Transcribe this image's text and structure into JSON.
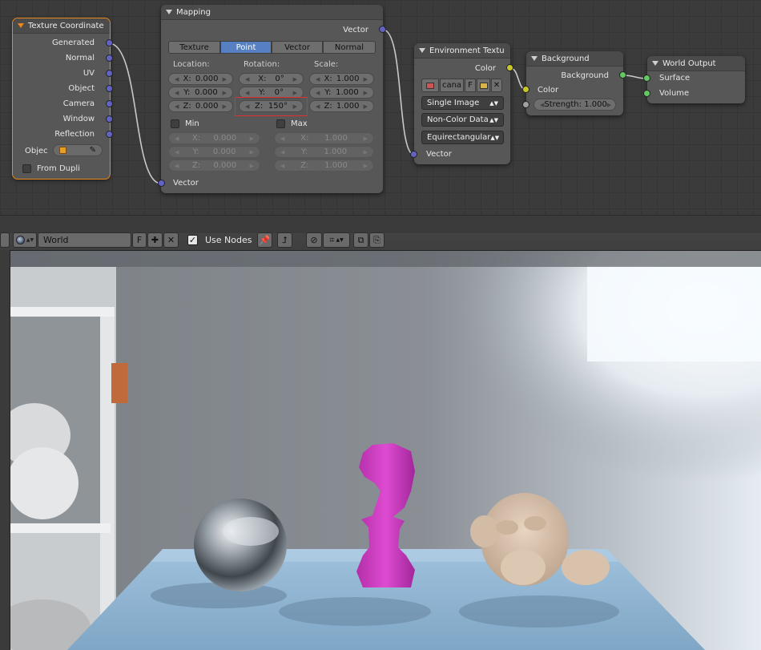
{
  "nodes": {
    "texture_coordinate": {
      "title": "Texture Coordinate",
      "outputs": [
        "Generated",
        "Normal",
        "UV",
        "Object",
        "Camera",
        "Window",
        "Reflection"
      ],
      "object_label": "Objec",
      "from_dupli_label": "From Dupli"
    },
    "mapping": {
      "title": "Mapping",
      "output_label": "Vector",
      "input_label": "Vector",
      "tabs": [
        "Texture",
        "Point",
        "Vector",
        "Normal"
      ],
      "active_tab": "Point",
      "headers": {
        "location": "Location:",
        "rotation": "Rotation:",
        "scale": "Scale:"
      },
      "location": [
        {
          "axis": "X:",
          "value": "0.000"
        },
        {
          "axis": "Y:",
          "value": "0.000"
        },
        {
          "axis": "Z:",
          "value": "0.000"
        }
      ],
      "rotation": [
        {
          "axis": "X:",
          "value": "0°"
        },
        {
          "axis": "Y:",
          "value": "0°"
        },
        {
          "axis": "Z:",
          "value": "150°"
        }
      ],
      "scale": [
        {
          "axis": "X:",
          "value": "1.000"
        },
        {
          "axis": "Y:",
          "value": "1.000"
        },
        {
          "axis": "Z:",
          "value": "1.000"
        }
      ],
      "min_label": "Min",
      "max_label": "Max",
      "min": [
        {
          "axis": "X:",
          "value": "0.000"
        },
        {
          "axis": "Y:",
          "value": "0.000"
        },
        {
          "axis": "Z:",
          "value": "0.000"
        }
      ],
      "max": [
        {
          "axis": "X:",
          "value": "1.000"
        },
        {
          "axis": "Y:",
          "value": "1.000"
        },
        {
          "axis": "Z:",
          "value": "1.000"
        }
      ]
    },
    "environment_texture": {
      "title": "Environment Textu",
      "output_label": "Color",
      "image_name": "cana",
      "fake_user": "F",
      "projection_source": "Single Image",
      "color_space": "Non-Color Data",
      "projection": "Equirectangular",
      "input_label": "Vector"
    },
    "background": {
      "title": "Background",
      "output_label": "Background",
      "color_label": "Color",
      "strength_label": "Strength:",
      "strength_value": "1.000"
    },
    "world_output": {
      "title": "World Output",
      "surface_label": "Surface",
      "volume_label": "Volume"
    }
  },
  "header": {
    "world_name": "World",
    "fake_user": "F",
    "use_nodes_label": "Use Nodes"
  },
  "colors": {
    "accent_active_node": "#e8871a",
    "active_tab": "#5680c2",
    "socket_vector": "#6363c7",
    "socket_color": "#c7c729",
    "socket_shader": "#63c763",
    "highlight_box": "#e03030"
  }
}
